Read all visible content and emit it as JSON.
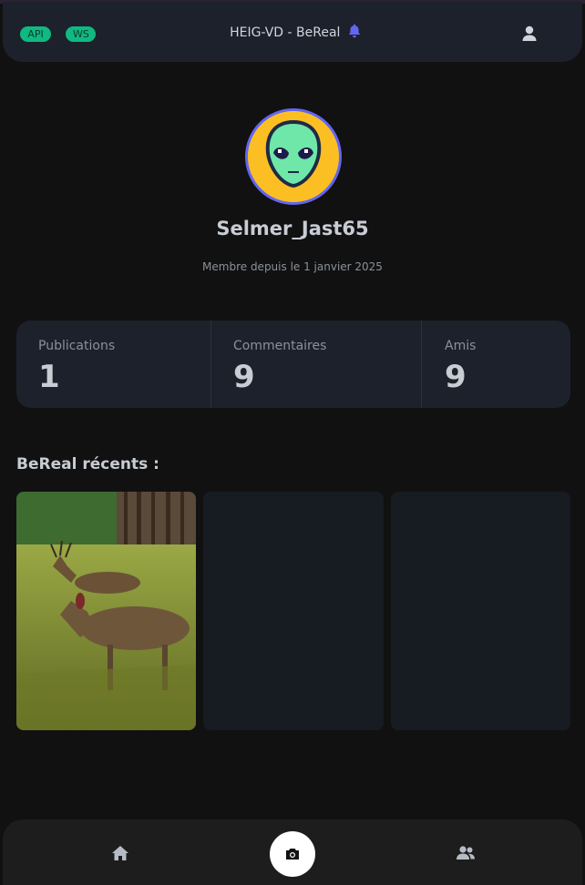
{
  "header": {
    "badges": [
      "API",
      "WS"
    ],
    "title": "HEIG-VD - BeReal",
    "accent_color": "#6366f1",
    "badge_color": "#10b981"
  },
  "profile": {
    "username": "Selmer_Jast65",
    "member_since": "Membre depuis le 1 janvier 2025"
  },
  "stats": [
    {
      "label": "Publications",
      "value": "1"
    },
    {
      "label": "Commentaires",
      "value": "9"
    },
    {
      "label": "Amis",
      "value": "9"
    }
  ],
  "recent": {
    "title": "BeReal récents :"
  },
  "nav": {
    "home_icon": "home-icon",
    "camera_icon": "camera-icon",
    "friends_icon": "users-icon"
  }
}
